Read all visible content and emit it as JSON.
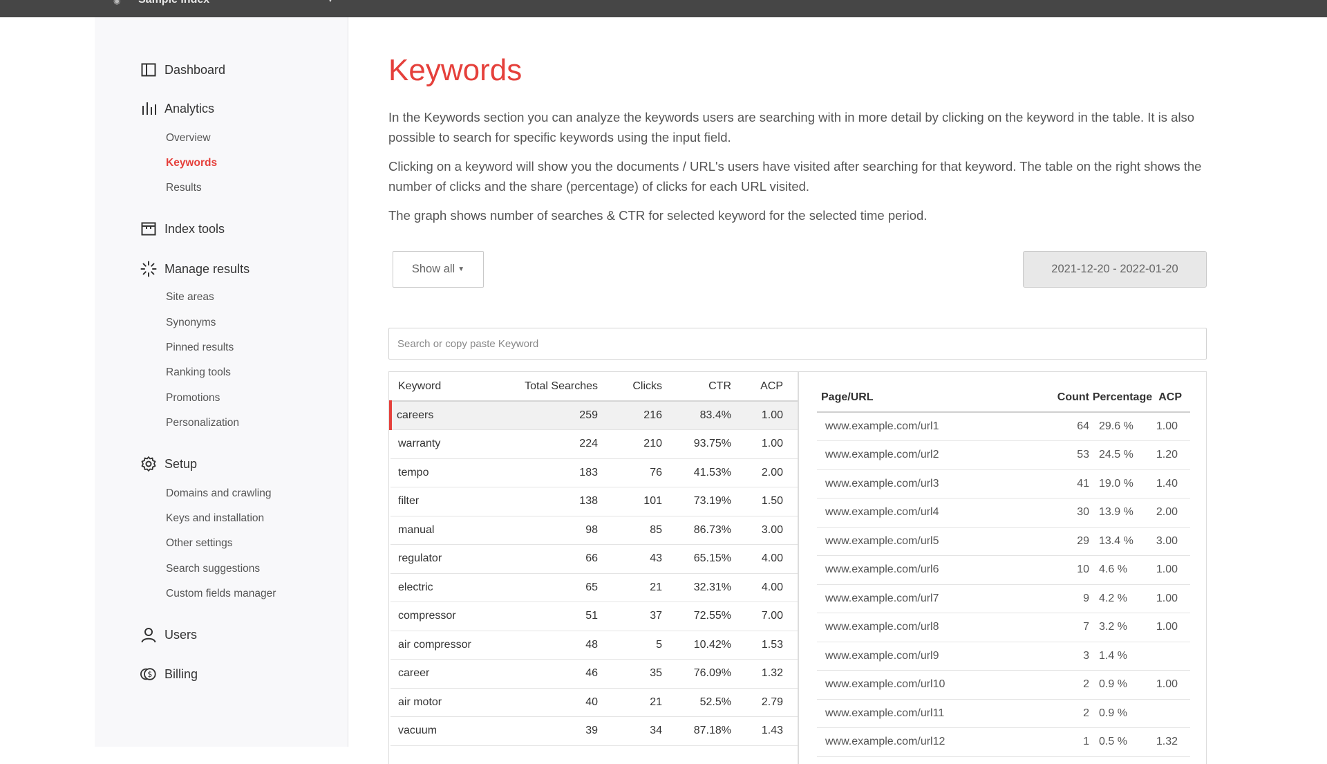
{
  "topbar": {
    "site_name": "Sample index"
  },
  "sidebar": {
    "dashboard": "Dashboard",
    "analytics": "Analytics",
    "analytics_items": [
      "Overview",
      "Keywords",
      "Results"
    ],
    "index_tools": "Index tools",
    "manage_results": "Manage results",
    "manage_items": [
      "Site areas",
      "Synonyms",
      "Pinned results",
      "Ranking tools",
      "Promotions",
      "Personalization"
    ],
    "setup": "Setup",
    "setup_items": [
      "Domains and crawling",
      "Keys and installation",
      "Other settings",
      "Search suggestions",
      "Custom fields manager"
    ],
    "users": "Users",
    "billing": "Billing"
  },
  "main": {
    "title": "Keywords",
    "paragraphs": [
      "In the Keywords section you can analyze the keywords users are searching with in more detail by clicking on the keyword in the table. It is also possible to search for specific keywords using the input field.",
      "Clicking on a keyword will show you the documents / URL's users have visited after searching for that keyword. The table on the right shows the number of clicks and the share (percentage) of clicks for each URL visited.",
      "The graph shows number of searches & CTR for selected keyword for the selected time period."
    ],
    "show_all_label": "Show all",
    "date_range": "2021-12-20 - 2022-01-20",
    "search_placeholder": "Search or copy paste Keyword"
  },
  "keywords_table": {
    "headers": [
      "Keyword",
      "Total Searches",
      "Clicks",
      "CTR",
      "ACP"
    ],
    "rows": [
      [
        "careers",
        "259",
        "216",
        "83.4%",
        "1.00"
      ],
      [
        "warranty",
        "224",
        "210",
        "93.75%",
        "1.00"
      ],
      [
        "tempo",
        "183",
        "76",
        "41.53%",
        "2.00"
      ],
      [
        "filter",
        "138",
        "101",
        "73.19%",
        "1.50"
      ],
      [
        "manual",
        "98",
        "85",
        "86.73%",
        "3.00"
      ],
      [
        "regulator",
        "66",
        "43",
        "65.15%",
        "4.00"
      ],
      [
        "electric",
        "65",
        "21",
        "32.31%",
        "4.00"
      ],
      [
        "compressor",
        "51",
        "37",
        "72.55%",
        "7.00"
      ],
      [
        "air compressor",
        "48",
        "5",
        "10.42%",
        "1.53"
      ],
      [
        "career",
        "46",
        "35",
        "76.09%",
        "1.32"
      ],
      [
        "air motor",
        "40",
        "21",
        "52.5%",
        "2.79"
      ],
      [
        "vacuum",
        "39",
        "34",
        "87.18%",
        "1.43"
      ]
    ]
  },
  "url_table": {
    "headers": [
      "Page/URL",
      "Count",
      "Percentage",
      "ACP"
    ],
    "rows": [
      [
        "www.example.com/url1",
        "64",
        "29.6 %",
        "1.00"
      ],
      [
        "www.example.com/url2",
        "53",
        "24.5 %",
        "1.20"
      ],
      [
        "www.example.com/url3",
        "41",
        "19.0 %",
        "1.40"
      ],
      [
        "www.example.com/url4",
        "30",
        "13.9 %",
        "2.00"
      ],
      [
        "www.example.com/url5",
        "29",
        "13.4 %",
        "3.00"
      ],
      [
        "www.example.com/url6",
        "10",
        "4.6 %",
        "1.00"
      ],
      [
        "www.example.com/url7",
        "9",
        "4.2 %",
        "1.00"
      ],
      [
        "www.example.com/url8",
        "7",
        "3.2 %",
        "1.00"
      ],
      [
        "www.example.com/url9",
        "3",
        "1.4 %",
        ""
      ],
      [
        "www.example.com/url10",
        "2",
        "0.9 %",
        "1.00"
      ],
      [
        "www.example.com/url11",
        "2",
        "0.9 %",
        ""
      ],
      [
        "www.example.com/url12",
        "1",
        "0.5 %",
        "1.32"
      ]
    ]
  },
  "colors": {
    "accent": "#e5403b",
    "topbar": "#464646",
    "sidebar_bg": "#f8f8fa"
  }
}
